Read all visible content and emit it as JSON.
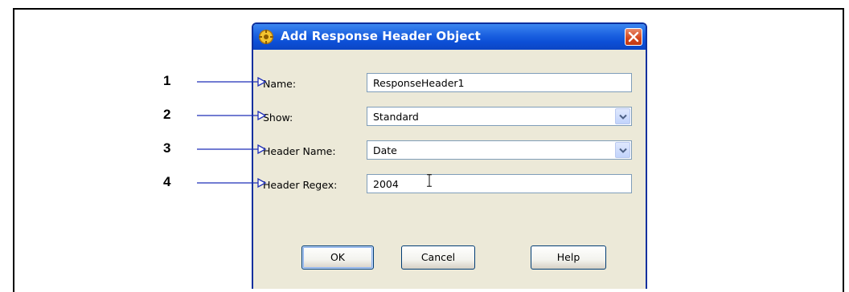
{
  "dialog": {
    "title": "Add Response Header Object",
    "close_label": "Close",
    "fields": {
      "name": {
        "label": "Name:",
        "value": "ResponseHeader1"
      },
      "show": {
        "label": "Show:",
        "value": "Standard"
      },
      "header_name": {
        "label": "Header Name:",
        "value": "Date"
      },
      "header_regex": {
        "label": "Header Regex:",
        "value": "2004"
      }
    },
    "buttons": {
      "ok": "OK",
      "cancel": "Cancel",
      "help": "Help"
    }
  },
  "callouts": [
    "1",
    "2",
    "3",
    "4"
  ],
  "colors": {
    "titlebar": "#0c4fd6",
    "dialog_bg": "#ece9d8",
    "callout_line": "#1f2fb8",
    "close": "#d3451b"
  },
  "icons": {
    "title": "gear-icon",
    "close": "close-icon",
    "dropdown": "chevron-down-icon"
  }
}
